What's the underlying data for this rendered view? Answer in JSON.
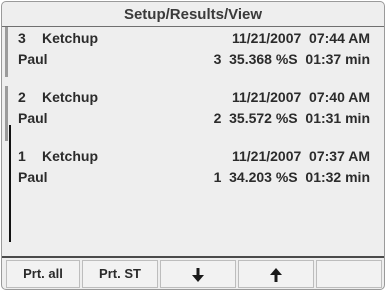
{
  "header": {
    "title": "Setup/Results/View"
  },
  "records": [
    {
      "number": "3",
      "product": "Ketchup",
      "datetime": "11/21/2007  07:44 AM",
      "user": "Paul",
      "result": "3  35.368 %S  01:37 min"
    },
    {
      "number": "2",
      "product": "Ketchup",
      "datetime": "11/21/2007  07:40 AM",
      "user": "Paul",
      "result": "2  35.572 %S  01:31 min"
    },
    {
      "number": "1",
      "product": "Ketchup",
      "datetime": "11/21/2007  07:37 AM",
      "user": "Paul",
      "result": "1  34.203 %S  01:32 min"
    }
  ],
  "softkeys": {
    "print_all": "Prt. all",
    "print_st": "Prt. ST",
    "down_icon": "arrow-down-icon",
    "up_icon": "arrow-up-icon",
    "empty": ""
  }
}
